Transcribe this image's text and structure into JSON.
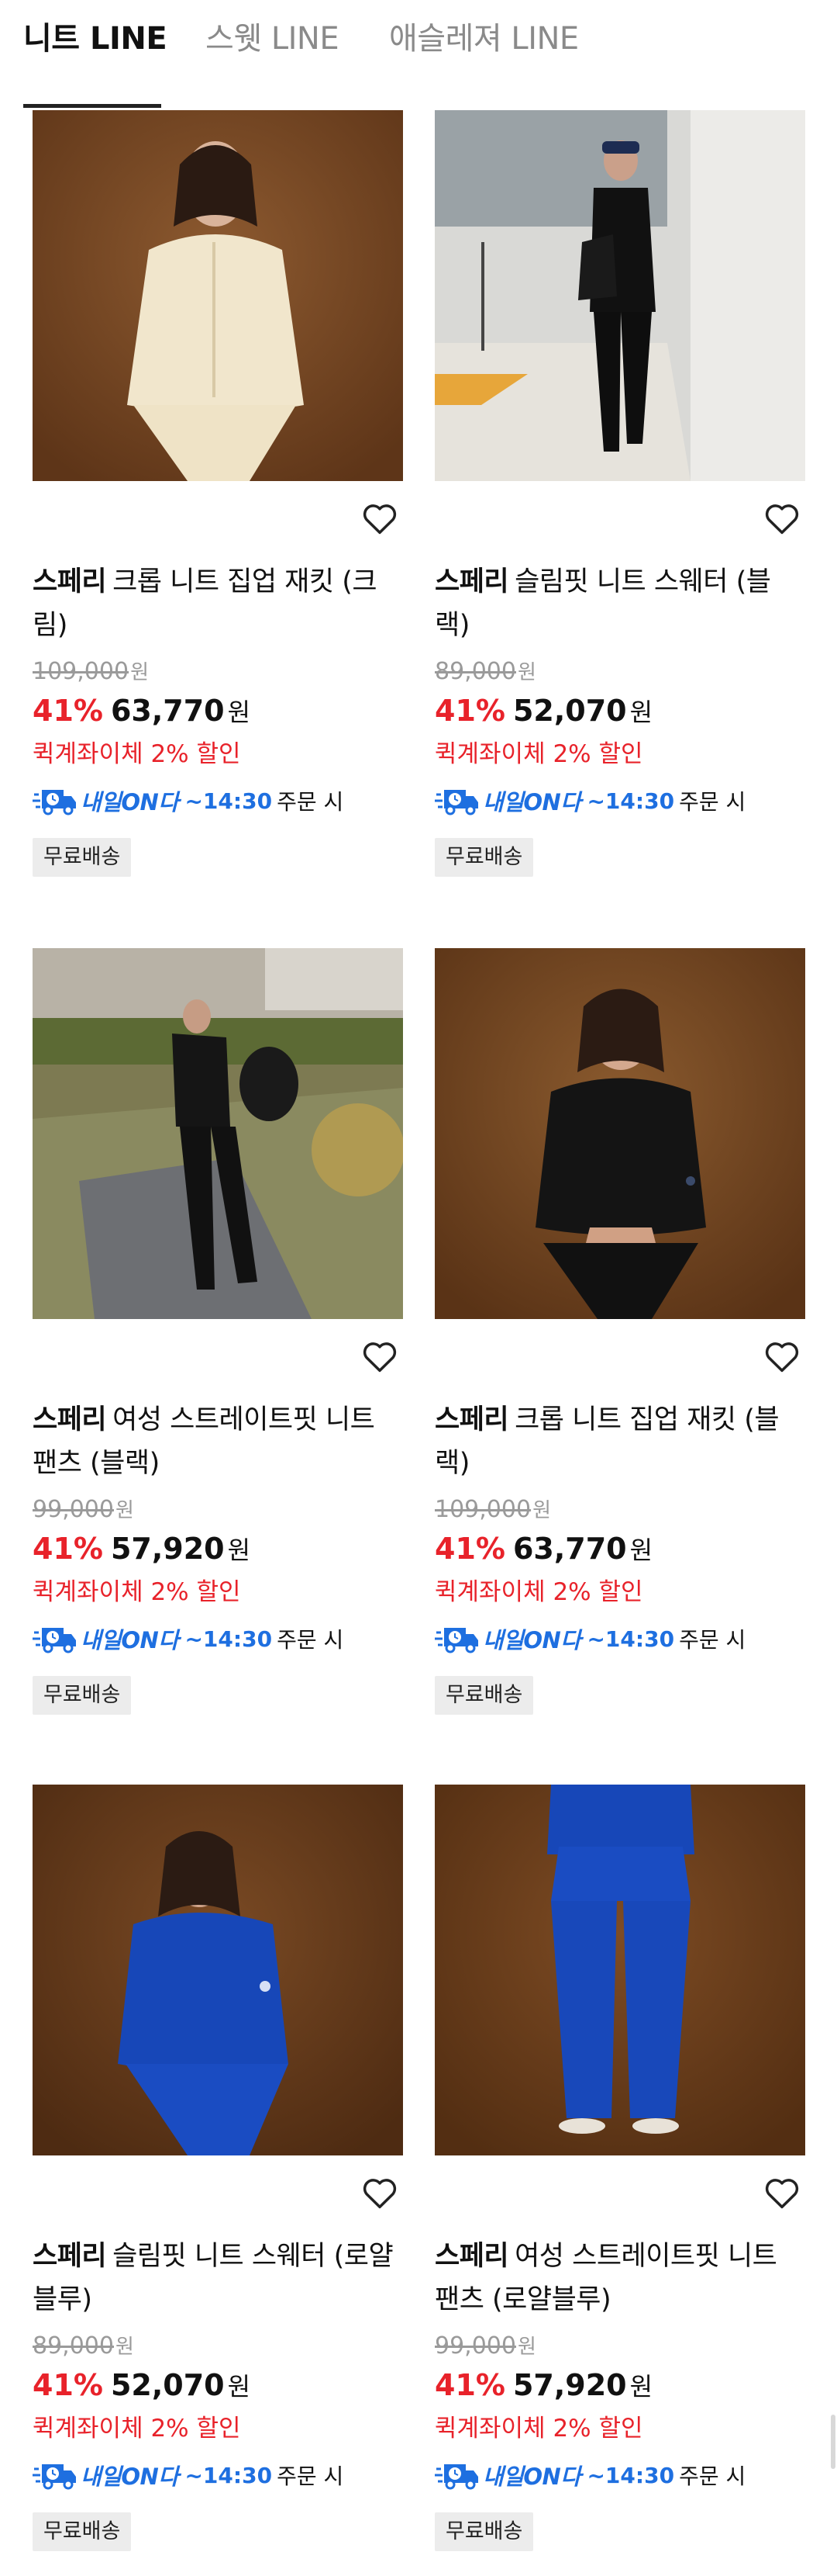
{
  "tabs": [
    {
      "label": "니트 LINE",
      "active": true
    },
    {
      "label": "스웻 LINE",
      "active": false
    },
    {
      "label": "애슬레져 LINE",
      "active": false
    }
  ],
  "shared": {
    "won": "원",
    "delivery_label": "내일ON다",
    "delivery_time": "~14:30",
    "delivery_suffix": "주문 시",
    "promo": "퀵계좌이체 2% 할인",
    "badge": "무료배송",
    "colors": {
      "discount": "#e8222a",
      "delivery": "#1e6fe0"
    }
  },
  "products": [
    {
      "brand": "스페리",
      "name": "크롭 니트 집업 재킷 (크림)",
      "original_price": "109,000",
      "discount": "41%",
      "price": "63,770",
      "image": "model-cream-zip-jacket",
      "icon": "heart-icon"
    },
    {
      "brand": "스페리",
      "name": "슬림핏 니트 스웨터 (블랙)",
      "original_price": "89,000",
      "discount": "41%",
      "price": "52,070",
      "image": "model-black-subway",
      "icon": "heart-icon"
    },
    {
      "brand": "스페리",
      "name": "여성 스트레이트핏 니트 팬츠 (블랙)",
      "original_price": "99,000",
      "discount": "41%",
      "price": "57,920",
      "image": "model-black-park",
      "icon": "heart-icon"
    },
    {
      "brand": "스페리",
      "name": "크롭 니트 집업 재킷 (블랙)",
      "original_price": "109,000",
      "discount": "41%",
      "price": "63,770",
      "image": "model-black-zip-jacket",
      "icon": "heart-icon"
    },
    {
      "brand": "스페리",
      "name": "슬림핏 니트 스웨터 (로얄블루)",
      "original_price": "89,000",
      "discount": "41%",
      "price": "52,070",
      "image": "model-royalblue-sweater",
      "icon": "heart-icon"
    },
    {
      "brand": "스페리",
      "name": "여성 스트레이트핏 니트 팬츠 (로얄블루)",
      "original_price": "99,000",
      "discount": "41%",
      "price": "57,920",
      "image": "model-royalblue-pants",
      "icon": "heart-icon"
    }
  ]
}
